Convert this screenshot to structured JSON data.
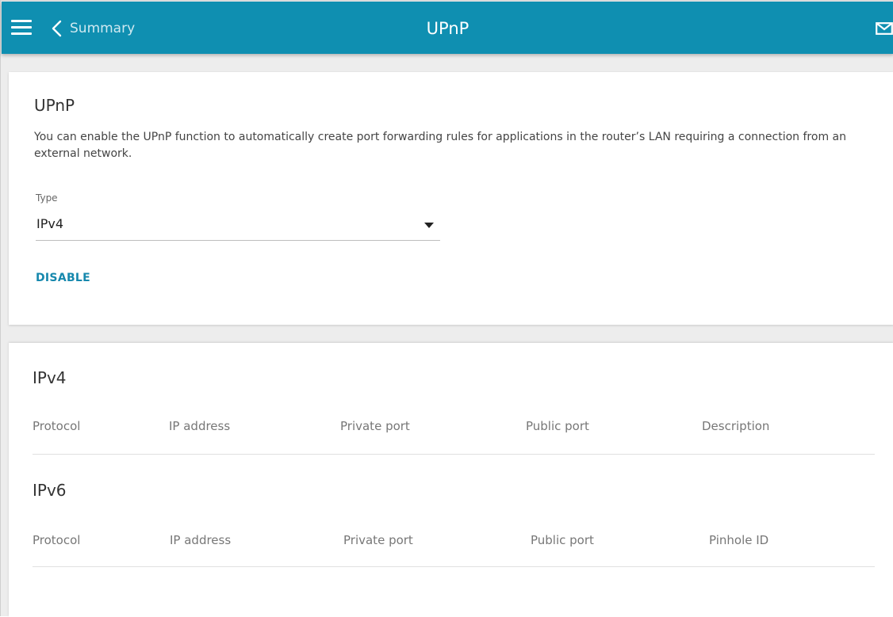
{
  "header": {
    "back_label": "Summary",
    "title": "UPnP",
    "menu_icon": "hamburger-menu-icon",
    "back_icon": "chevron-left-icon",
    "mail_icon": "mail-icon",
    "bar_color": "#0f8fb1"
  },
  "upnp": {
    "title": "UPnP",
    "description": "You can enable the UPnP function to automatically create port forwarding rules for applications in the router’s LAN requiring a connection from an external network.",
    "type_label": "Type",
    "type_value": "IPv4",
    "disable_label": "DISABLE"
  },
  "ipv4": {
    "title": "IPv4",
    "columns": [
      "Protocol",
      "IP address",
      "Private port",
      "Public port",
      "Description"
    ]
  },
  "ipv6": {
    "title": "IPv6",
    "columns": [
      "Protocol",
      "IP address",
      "Private port",
      "Public port",
      "Pinhole ID"
    ]
  }
}
